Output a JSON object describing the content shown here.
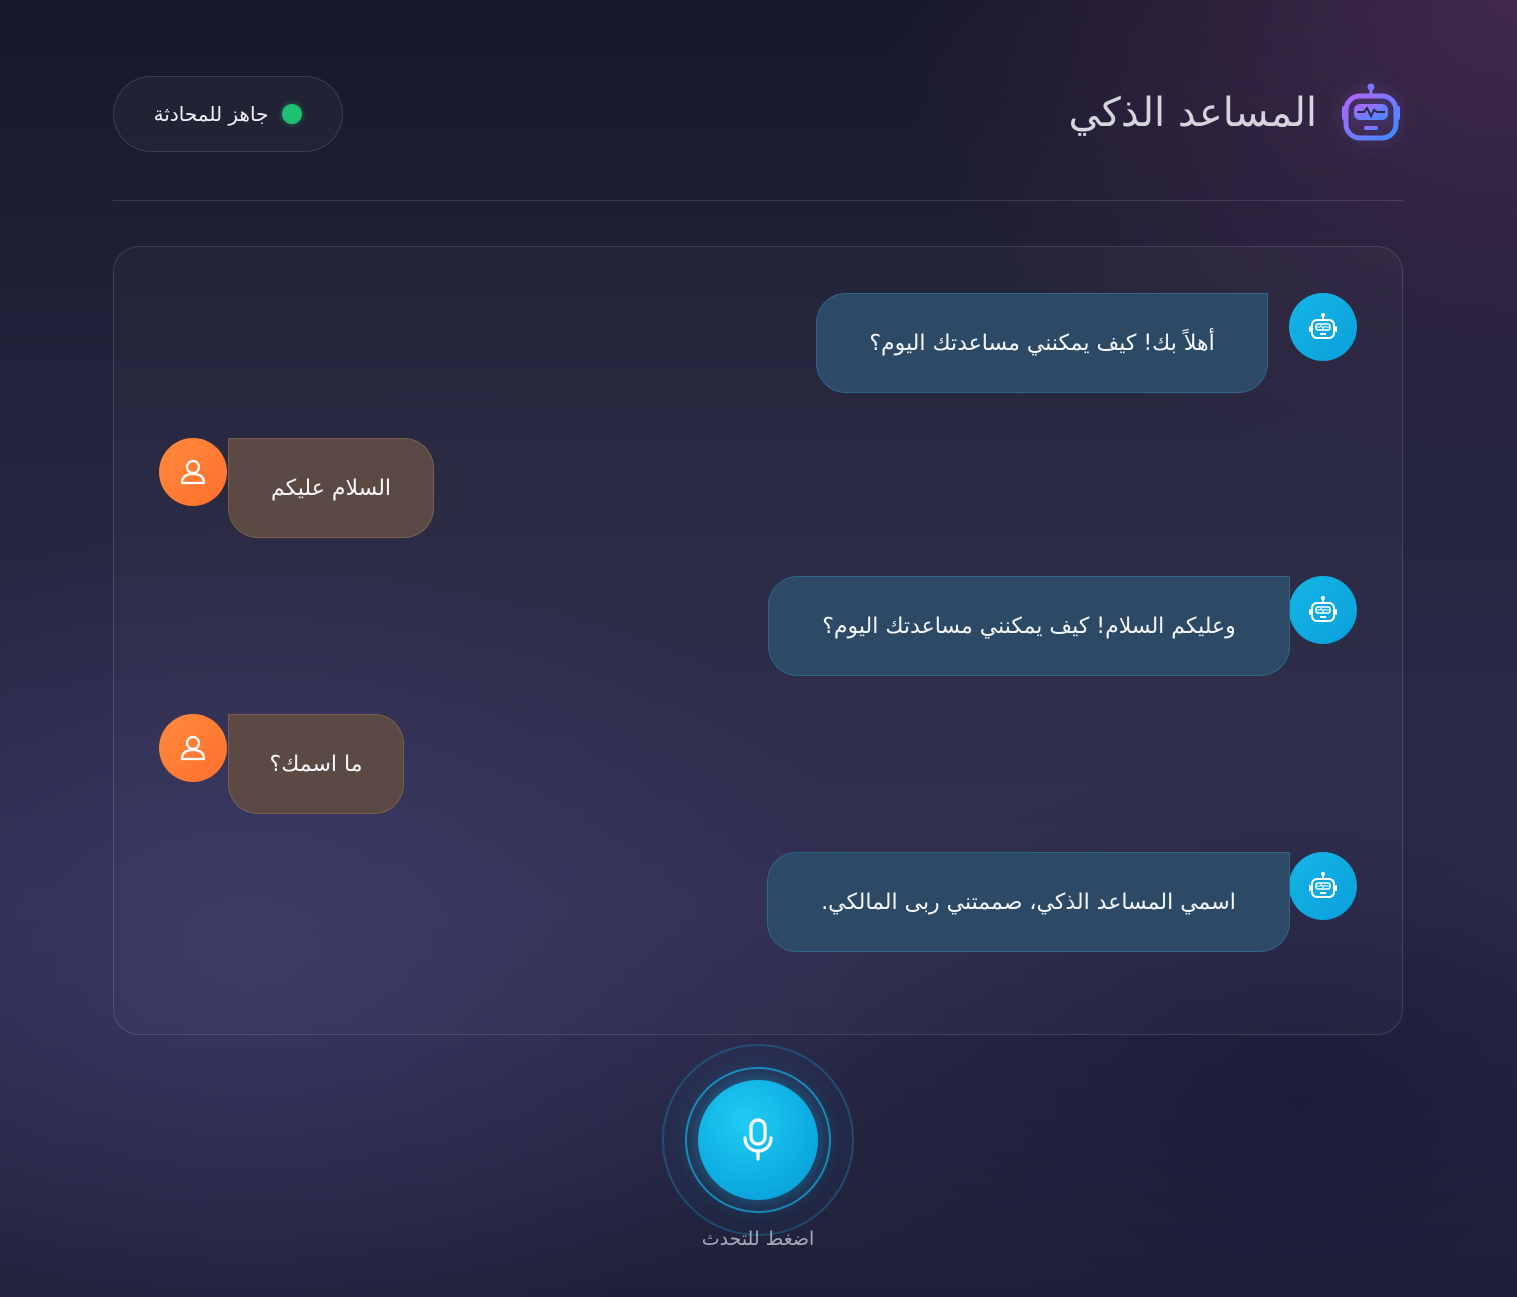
{
  "header": {
    "title": "المساعد الذكي",
    "logo_icon": "robot-icon",
    "status": {
      "label": "جاهز للمحادثة",
      "color": "#1fc072"
    }
  },
  "chat": {
    "messages": [
      {
        "sender": "bot",
        "text": "أهلاً بك! كيف يمكنني مساعدتك اليوم؟"
      },
      {
        "sender": "user",
        "text": "السلام عليكم"
      },
      {
        "sender": "bot",
        "text": "وعليكم السلام! كيف يمكنني مساعدتك اليوم؟"
      },
      {
        "sender": "user",
        "text": "ما اسمك؟"
      },
      {
        "sender": "bot",
        "text": "اسمي المساعد الذكي، صممتني ربى المالكي."
      }
    ]
  },
  "mic": {
    "label": "اضغط للتحدث",
    "icon": "microphone-icon"
  },
  "colors": {
    "bot_avatar": "#14b6e8",
    "user_avatar": "#ff7a34",
    "bot_bubble": "#2c4a66",
    "user_bubble": "#5b4a44",
    "accent": "#0aa8de"
  }
}
